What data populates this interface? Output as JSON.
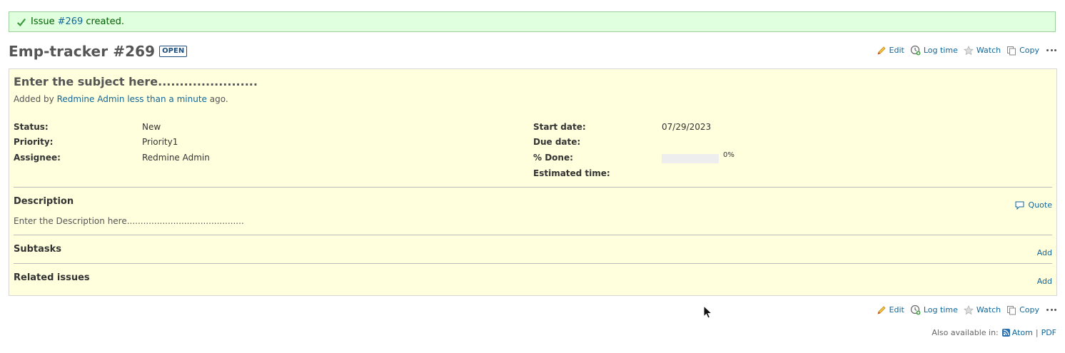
{
  "flash": {
    "prefix": "Issue",
    "issue_link": "#269",
    "suffix": "created."
  },
  "header": {
    "title": "Emp-tracker #269",
    "status_badge": "OPEN"
  },
  "actions": {
    "edit": "Edit",
    "log_time": "Log time",
    "watch": "Watch",
    "copy": "Copy"
  },
  "issue": {
    "subject": "Enter the subject here.......................",
    "added_by_prefix": "Added by",
    "author": "Redmine Admin",
    "age": "less than a minute",
    "added_by_suffix": "ago.",
    "attributes_left": [
      {
        "label": "Status:",
        "value": "New"
      },
      {
        "label": "Priority:",
        "value": "Priority1"
      },
      {
        "label": "Assignee:",
        "value": "Redmine Admin"
      }
    ],
    "attributes_right": [
      {
        "label": "Start date:",
        "value": "07/29/2023"
      },
      {
        "label": "Due date:",
        "value": ""
      },
      {
        "label": "% Done:",
        "value": "0%",
        "progress": 0
      },
      {
        "label": "Estimated time:",
        "value": ""
      }
    ],
    "description": {
      "title": "Description",
      "quote": "Quote",
      "text": "Enter the Description here..........................................."
    },
    "subtasks": {
      "title": "Subtasks",
      "add": "Add"
    },
    "related": {
      "title": "Related issues",
      "add": "Add"
    }
  },
  "footer": {
    "also_available": "Also available in:",
    "atom": "Atom",
    "separator": "|",
    "pdf": "PDF"
  },
  "colors": {
    "link": "#1166aa",
    "issue_bg": "#ffffdd",
    "flash_bg": "#dfffdf",
    "badge": "#1D4E7E"
  }
}
